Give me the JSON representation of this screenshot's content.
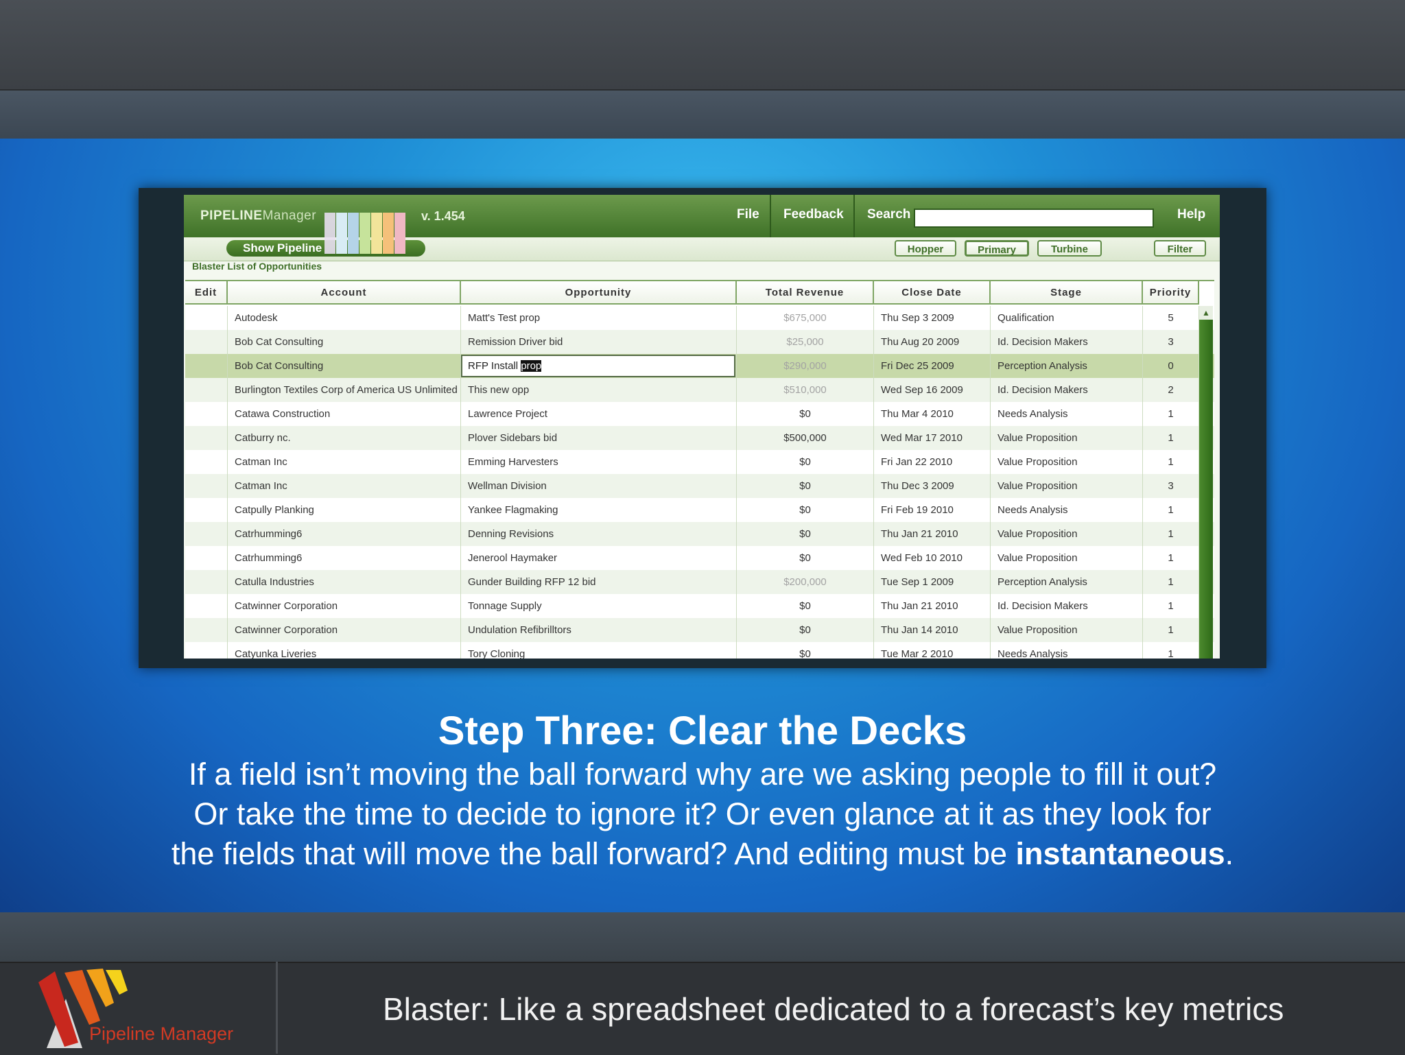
{
  "app": {
    "brand_main": "PIPELINE",
    "brand_sub": "Manager",
    "version": "v. 1.454",
    "menu": {
      "file": "File",
      "feedback": "Feedback",
      "search": "Search",
      "help": "Help"
    },
    "search_value": "",
    "show_pipeline": "Show Pipeline",
    "tabs": {
      "hopper": "Hopper",
      "primary": "Primary",
      "turbine": "Turbine",
      "filter": "Filter"
    },
    "list_title": "Blaster List of Opportunities",
    "columns": {
      "edit": "Edit",
      "account": "Account",
      "opportunity": "Opportunity",
      "revenue": "Total Revenue",
      "close": "Close Date",
      "stage": "Stage",
      "priority": "Priority"
    },
    "rows": [
      {
        "account": "Autodesk",
        "opportunity": "Matt's Test prop",
        "revenue": "$675,000",
        "close": "Thu Sep 3 2009",
        "stage": "Qualification",
        "priority": "5"
      },
      {
        "account": "Bob Cat Consulting",
        "opportunity": "Remission Driver bid",
        "revenue": "$25,000",
        "close": "Thu Aug 20 2009",
        "stage": "Id. Decision Makers",
        "priority": "3"
      },
      {
        "account": "Bob Cat Consulting",
        "opportunity": "RFP Install ",
        "opportunity_selected": "prop",
        "revenue": "$290,000",
        "close": "Fri Dec 25 2009",
        "stage": "Perception Analysis",
        "priority": "0"
      },
      {
        "account": "Burlington Textiles Corp of America US Unlimited Ltd.",
        "opportunity": "This new opp",
        "revenue": "$510,000",
        "close": "Wed Sep 16 2009",
        "stage": "Id. Decision Makers",
        "priority": "2"
      },
      {
        "account": "Catawa Construction",
        "opportunity": "Lawrence Project",
        "revenue": "$0",
        "close": "Thu Mar 4 2010",
        "stage": "Needs Analysis",
        "priority": "1"
      },
      {
        "account": "Catburry nc.",
        "opportunity": "Plover Sidebars bid",
        "revenue": "$500,000",
        "close": "Wed Mar 17 2010",
        "stage": "Value Proposition",
        "priority": "1"
      },
      {
        "account": "Catman Inc",
        "opportunity": "Emming Harvesters",
        "revenue": "$0",
        "close": "Fri Jan 22 2010",
        "stage": "Value Proposition",
        "priority": "1"
      },
      {
        "account": "Catman Inc",
        "opportunity": "Wellman Division",
        "revenue": "$0",
        "close": "Thu Dec 3 2009",
        "stage": "Value Proposition",
        "priority": "3"
      },
      {
        "account": "Catpully Planking",
        "opportunity": "Yankee Flagmaking",
        "revenue": "$0",
        "close": "Fri Feb 19 2010",
        "stage": "Needs Analysis",
        "priority": "1"
      },
      {
        "account": "Catrhumming6",
        "opportunity": "Denning Revisions",
        "revenue": "$0",
        "close": "Thu Jan 21 2010",
        "stage": "Value Proposition",
        "priority": "1"
      },
      {
        "account": "Catrhumming6",
        "opportunity": "Jenerool Haymaker",
        "revenue": "$0",
        "close": "Wed Feb 10 2010",
        "stage": "Value Proposition",
        "priority": "1"
      },
      {
        "account": "Catulla Industries",
        "opportunity": "Gunder Building RFP 12 bid",
        "revenue": "$200,000",
        "close": "Tue Sep 1 2009",
        "stage": "Perception Analysis",
        "priority": "1"
      },
      {
        "account": "Catwinner Corporation",
        "opportunity": "Tonnage Supply",
        "revenue": "$0",
        "close": "Thu Jan 21 2010",
        "stage": "Id. Decision Makers",
        "priority": "1"
      },
      {
        "account": "Catwinner Corporation",
        "opportunity": "Undulation Refibrilltors",
        "revenue": "$0",
        "close": "Thu Jan 14 2010",
        "stage": "Value Proposition",
        "priority": "1"
      },
      {
        "account": "Catyunka Liveries",
        "opportunity": "Tory Cloning",
        "revenue": "$0",
        "close": "Tue Mar 2 2010",
        "stage": "Needs Analysis",
        "priority": "1"
      }
    ]
  },
  "slide": {
    "title": "Step Three: Clear the Decks",
    "body_line1": "If a field isn’t moving the ball forward why are we asking people to fill it out?",
    "body_line2": "Or take the time to decide to ignore it?  Or even glance at it as they look for",
    "body_line3_pre": "the fields that will move the ball forward? And editing must be ",
    "body_line3_em": "instantaneous",
    "body_line3_post": "."
  },
  "footer": {
    "logo_text": "Pipeline Manager",
    "caption": "Blaster: Like a spreadsheet dedicated to a forecast’s key metrics"
  },
  "colors": {
    "accent": "#3f7228",
    "brand_red": "#d23a24"
  }
}
